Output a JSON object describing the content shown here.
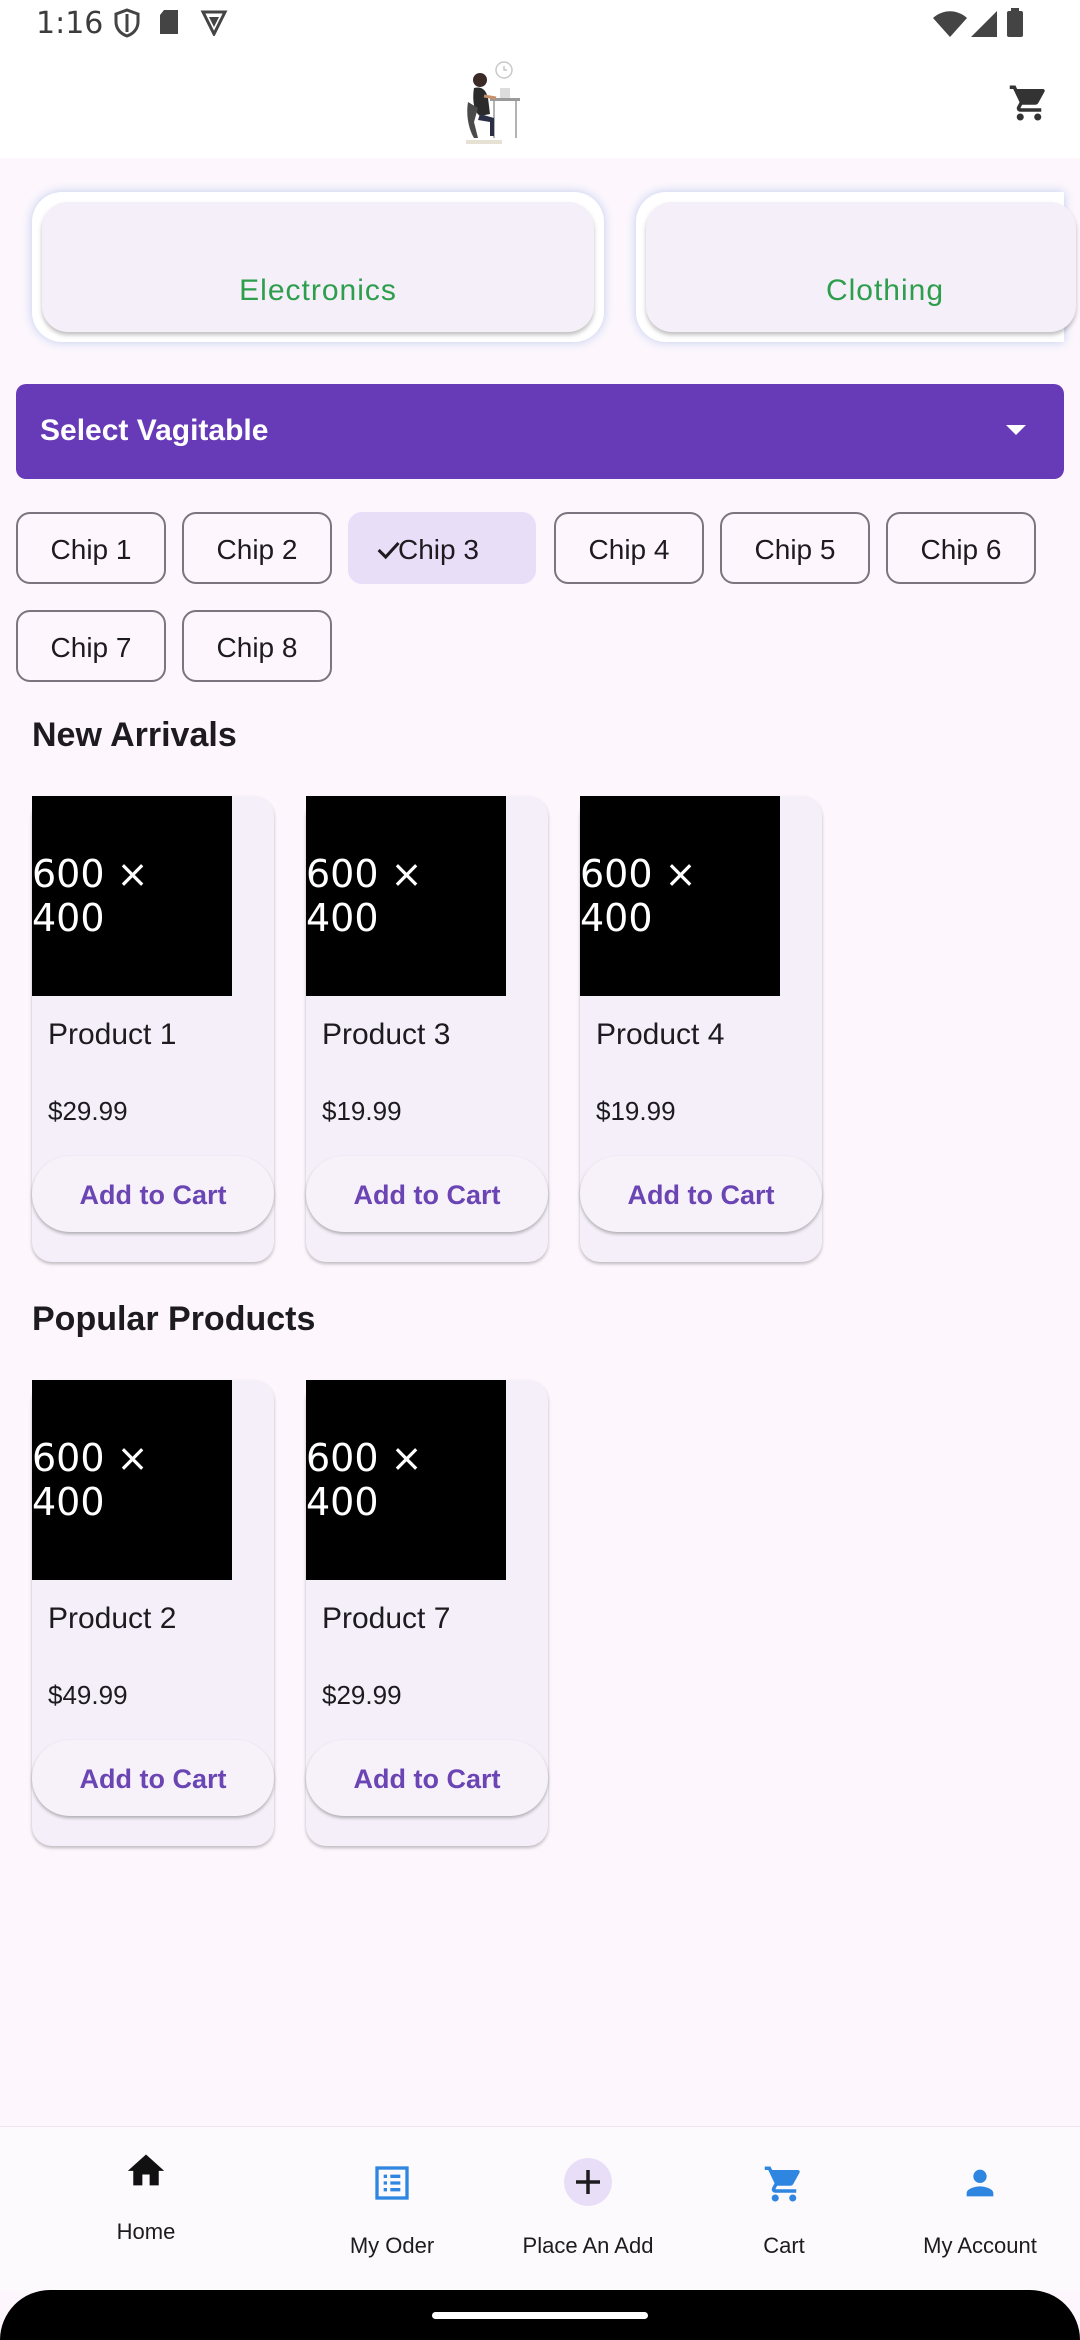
{
  "status_bar": {
    "time": "1:16"
  },
  "categories": [
    {
      "label": "Electronics"
    },
    {
      "label": "Clothing"
    }
  ],
  "dropdown": {
    "label": "Select Vagitable"
  },
  "chips": [
    {
      "label": "Chip 1",
      "selected": false
    },
    {
      "label": "Chip 2",
      "selected": false
    },
    {
      "label": "Chip 3",
      "selected": true
    },
    {
      "label": "Chip 4",
      "selected": false
    },
    {
      "label": "Chip 5",
      "selected": false
    },
    {
      "label": "Chip 6",
      "selected": false
    },
    {
      "label": "Chip 7",
      "selected": false
    },
    {
      "label": "Chip 8",
      "selected": false
    }
  ],
  "new_arrivals": {
    "title": "New Arrivals",
    "products": [
      {
        "image_text": "600 × 400",
        "name": "Product 1",
        "price": "$29.99",
        "button": "Add to Cart"
      },
      {
        "image_text": "600 × 400",
        "name": "Product 3",
        "price": "$19.99",
        "button": "Add to Cart"
      },
      {
        "image_text": "600 × 400",
        "name": "Product 4",
        "price": "$19.99",
        "button": "Add to Cart"
      }
    ]
  },
  "popular_products": {
    "title": "Popular Products",
    "products": [
      {
        "image_text": "600 × 400",
        "name": "Product 2",
        "price": "$49.99",
        "button": "Add to Cart"
      },
      {
        "image_text": "600 × 400",
        "name": "Product 7",
        "price": "$29.99",
        "button": "Add to Cart"
      }
    ]
  },
  "bottom_nav": {
    "items": [
      {
        "label": "Home",
        "icon": "home-icon",
        "active": true
      },
      {
        "label": "My Oder",
        "icon": "list-icon",
        "active": false
      },
      {
        "label": "Place An Add",
        "icon": "add-circle-icon",
        "active": false
      },
      {
        "label": "Cart",
        "icon": "cart-icon",
        "active": false
      },
      {
        "label": "My Account",
        "icon": "person-icon",
        "active": false
      }
    ]
  },
  "colors": {
    "primary": "#673ab7",
    "category_text": "#2e9e4c",
    "nav_icon": "#2f86e0",
    "button_text": "#6a45b3",
    "chip_selected_bg": "#e8def8"
  }
}
